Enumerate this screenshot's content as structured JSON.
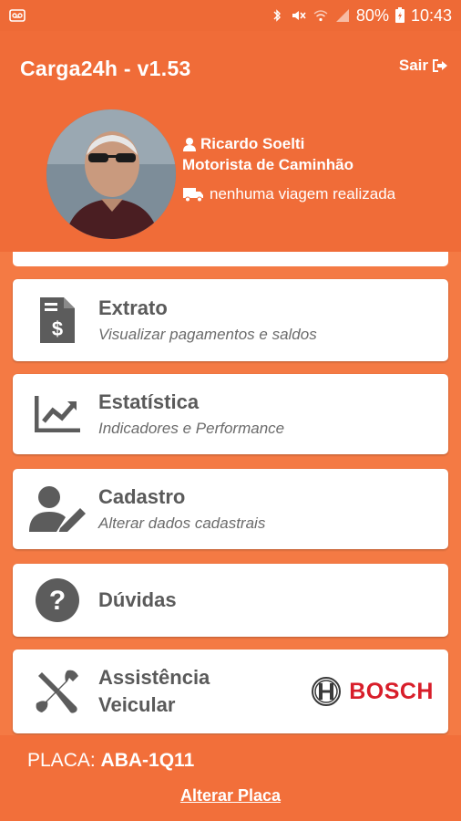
{
  "status_bar": {
    "battery_percent": "80%",
    "time": "10:43"
  },
  "header": {
    "app_title": "Carga24h - v1.53",
    "logout_label": "Sair",
    "user_name": "Ricardo Soelti",
    "user_role": "Motorista de Caminhão",
    "trips_status": "nenhuma viagem realizada"
  },
  "menu": {
    "items": [
      {
        "title": "Extrato",
        "subtitle": "Visualizar pagamentos e saldos",
        "icon": "invoice-dollar-icon"
      },
      {
        "title": "Estatística",
        "subtitle": "Indicadores e Performance",
        "icon": "chart-line-icon"
      },
      {
        "title": "Cadastro",
        "subtitle": "Alterar dados cadastrais",
        "icon": "user-edit-icon"
      },
      {
        "title": "Dúvidas",
        "subtitle": "",
        "icon": "question-circle-icon"
      },
      {
        "title_line1": "Assistência",
        "title_line2": "Veicular",
        "brand": "BOSCH",
        "icon": "tools-icon"
      }
    ]
  },
  "footer": {
    "plate_label": "PLACA:",
    "plate_value": "ABA-1Q11",
    "change_plate_label": "Alterar Placa"
  },
  "colors": {
    "primary": "#f06c38",
    "background": "#f47a44",
    "icon_gray": "#5c5c5c",
    "bosch_red": "#d81e2a"
  }
}
